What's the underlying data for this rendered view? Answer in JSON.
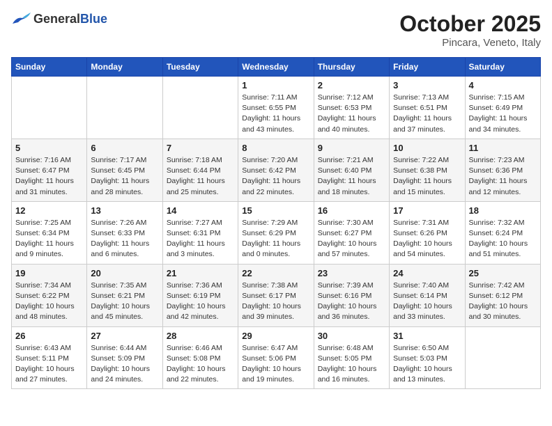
{
  "header": {
    "logo_general": "General",
    "logo_blue": "Blue",
    "month_title": "October 2025",
    "location": "Pincara, Veneto, Italy"
  },
  "weekdays": [
    "Sunday",
    "Monday",
    "Tuesday",
    "Wednesday",
    "Thursday",
    "Friday",
    "Saturday"
  ],
  "weeks": [
    [
      {
        "day": "",
        "sunrise": "",
        "sunset": "",
        "daylight": ""
      },
      {
        "day": "",
        "sunrise": "",
        "sunset": "",
        "daylight": ""
      },
      {
        "day": "",
        "sunrise": "",
        "sunset": "",
        "daylight": ""
      },
      {
        "day": "1",
        "sunrise": "Sunrise: 7:11 AM",
        "sunset": "Sunset: 6:55 PM",
        "daylight": "Daylight: 11 hours and 43 minutes."
      },
      {
        "day": "2",
        "sunrise": "Sunrise: 7:12 AM",
        "sunset": "Sunset: 6:53 PM",
        "daylight": "Daylight: 11 hours and 40 minutes."
      },
      {
        "day": "3",
        "sunrise": "Sunrise: 7:13 AM",
        "sunset": "Sunset: 6:51 PM",
        "daylight": "Daylight: 11 hours and 37 minutes."
      },
      {
        "day": "4",
        "sunrise": "Sunrise: 7:15 AM",
        "sunset": "Sunset: 6:49 PM",
        "daylight": "Daylight: 11 hours and 34 minutes."
      }
    ],
    [
      {
        "day": "5",
        "sunrise": "Sunrise: 7:16 AM",
        "sunset": "Sunset: 6:47 PM",
        "daylight": "Daylight: 11 hours and 31 minutes."
      },
      {
        "day": "6",
        "sunrise": "Sunrise: 7:17 AM",
        "sunset": "Sunset: 6:45 PM",
        "daylight": "Daylight: 11 hours and 28 minutes."
      },
      {
        "day": "7",
        "sunrise": "Sunrise: 7:18 AM",
        "sunset": "Sunset: 6:44 PM",
        "daylight": "Daylight: 11 hours and 25 minutes."
      },
      {
        "day": "8",
        "sunrise": "Sunrise: 7:20 AM",
        "sunset": "Sunset: 6:42 PM",
        "daylight": "Daylight: 11 hours and 22 minutes."
      },
      {
        "day": "9",
        "sunrise": "Sunrise: 7:21 AM",
        "sunset": "Sunset: 6:40 PM",
        "daylight": "Daylight: 11 hours and 18 minutes."
      },
      {
        "day": "10",
        "sunrise": "Sunrise: 7:22 AM",
        "sunset": "Sunset: 6:38 PM",
        "daylight": "Daylight: 11 hours and 15 minutes."
      },
      {
        "day": "11",
        "sunrise": "Sunrise: 7:23 AM",
        "sunset": "Sunset: 6:36 PM",
        "daylight": "Daylight: 11 hours and 12 minutes."
      }
    ],
    [
      {
        "day": "12",
        "sunrise": "Sunrise: 7:25 AM",
        "sunset": "Sunset: 6:34 PM",
        "daylight": "Daylight: 11 hours and 9 minutes."
      },
      {
        "day": "13",
        "sunrise": "Sunrise: 7:26 AM",
        "sunset": "Sunset: 6:33 PM",
        "daylight": "Daylight: 11 hours and 6 minutes."
      },
      {
        "day": "14",
        "sunrise": "Sunrise: 7:27 AM",
        "sunset": "Sunset: 6:31 PM",
        "daylight": "Daylight: 11 hours and 3 minutes."
      },
      {
        "day": "15",
        "sunrise": "Sunrise: 7:29 AM",
        "sunset": "Sunset: 6:29 PM",
        "daylight": "Daylight: 11 hours and 0 minutes."
      },
      {
        "day": "16",
        "sunrise": "Sunrise: 7:30 AM",
        "sunset": "Sunset: 6:27 PM",
        "daylight": "Daylight: 10 hours and 57 minutes."
      },
      {
        "day": "17",
        "sunrise": "Sunrise: 7:31 AM",
        "sunset": "Sunset: 6:26 PM",
        "daylight": "Daylight: 10 hours and 54 minutes."
      },
      {
        "day": "18",
        "sunrise": "Sunrise: 7:32 AM",
        "sunset": "Sunset: 6:24 PM",
        "daylight": "Daylight: 10 hours and 51 minutes."
      }
    ],
    [
      {
        "day": "19",
        "sunrise": "Sunrise: 7:34 AM",
        "sunset": "Sunset: 6:22 PM",
        "daylight": "Daylight: 10 hours and 48 minutes."
      },
      {
        "day": "20",
        "sunrise": "Sunrise: 7:35 AM",
        "sunset": "Sunset: 6:21 PM",
        "daylight": "Daylight: 10 hours and 45 minutes."
      },
      {
        "day": "21",
        "sunrise": "Sunrise: 7:36 AM",
        "sunset": "Sunset: 6:19 PM",
        "daylight": "Daylight: 10 hours and 42 minutes."
      },
      {
        "day": "22",
        "sunrise": "Sunrise: 7:38 AM",
        "sunset": "Sunset: 6:17 PM",
        "daylight": "Daylight: 10 hours and 39 minutes."
      },
      {
        "day": "23",
        "sunrise": "Sunrise: 7:39 AM",
        "sunset": "Sunset: 6:16 PM",
        "daylight": "Daylight: 10 hours and 36 minutes."
      },
      {
        "day": "24",
        "sunrise": "Sunrise: 7:40 AM",
        "sunset": "Sunset: 6:14 PM",
        "daylight": "Daylight: 10 hours and 33 minutes."
      },
      {
        "day": "25",
        "sunrise": "Sunrise: 7:42 AM",
        "sunset": "Sunset: 6:12 PM",
        "daylight": "Daylight: 10 hours and 30 minutes."
      }
    ],
    [
      {
        "day": "26",
        "sunrise": "Sunrise: 6:43 AM",
        "sunset": "Sunset: 5:11 PM",
        "daylight": "Daylight: 10 hours and 27 minutes."
      },
      {
        "day": "27",
        "sunrise": "Sunrise: 6:44 AM",
        "sunset": "Sunset: 5:09 PM",
        "daylight": "Daylight: 10 hours and 24 minutes."
      },
      {
        "day": "28",
        "sunrise": "Sunrise: 6:46 AM",
        "sunset": "Sunset: 5:08 PM",
        "daylight": "Daylight: 10 hours and 22 minutes."
      },
      {
        "day": "29",
        "sunrise": "Sunrise: 6:47 AM",
        "sunset": "Sunset: 5:06 PM",
        "daylight": "Daylight: 10 hours and 19 minutes."
      },
      {
        "day": "30",
        "sunrise": "Sunrise: 6:48 AM",
        "sunset": "Sunset: 5:05 PM",
        "daylight": "Daylight: 10 hours and 16 minutes."
      },
      {
        "day": "31",
        "sunrise": "Sunrise: 6:50 AM",
        "sunset": "Sunset: 5:03 PM",
        "daylight": "Daylight: 10 hours and 13 minutes."
      },
      {
        "day": "",
        "sunrise": "",
        "sunset": "",
        "daylight": ""
      }
    ]
  ]
}
